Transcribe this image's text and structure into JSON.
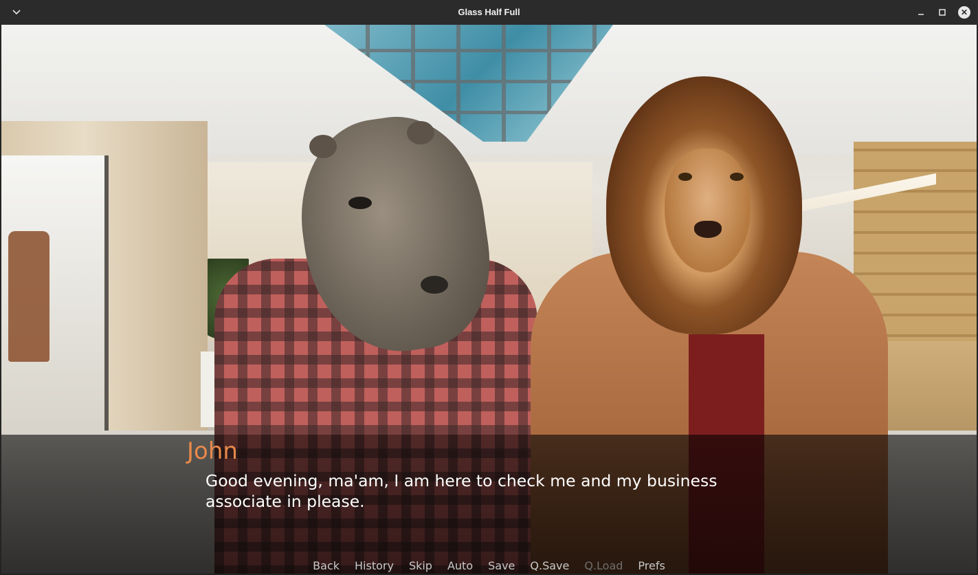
{
  "window": {
    "title": "Glass Half Full"
  },
  "dialogue": {
    "speaker": "John",
    "text": "Good evening, ma'am, I am here to check me and my business associate in please.",
    "speaker_color": "#e8894a"
  },
  "quick_menu": [
    {
      "label": "Back",
      "enabled": true
    },
    {
      "label": "History",
      "enabled": true
    },
    {
      "label": "Skip",
      "enabled": true
    },
    {
      "label": "Auto",
      "enabled": true
    },
    {
      "label": "Save",
      "enabled": true
    },
    {
      "label": "Q.Save",
      "enabled": true
    },
    {
      "label": "Q.Load",
      "enabled": false
    },
    {
      "label": "Prefs",
      "enabled": true
    }
  ],
  "icons": {
    "menu": "chevron-down-icon",
    "minimize": "minimize-icon",
    "maximize": "maximize-icon",
    "close": "close-icon"
  }
}
